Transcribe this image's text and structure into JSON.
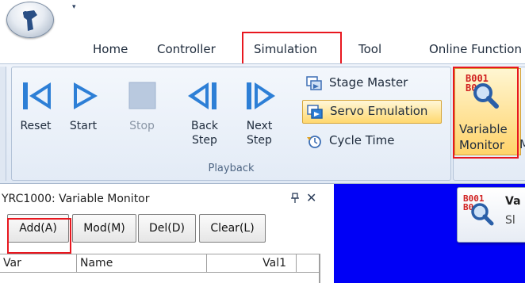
{
  "app": {
    "logo_icon": "robot-arm-icon",
    "qat_dropdown_icon": "quick-access-dropdown-icon"
  },
  "tabs": [
    {
      "label": "Home"
    },
    {
      "label": "Controller"
    },
    {
      "label": "Simulation",
      "highlighted": true
    },
    {
      "label": "Tool"
    },
    {
      "label": "Online Function"
    }
  ],
  "ribbon": {
    "playback_group_label": "Playback",
    "buttons": {
      "reset": "Reset",
      "start": "Start",
      "stop": "Stop",
      "back_step": "Back\nStep",
      "next_step": "Next\nStep"
    },
    "small_buttons": {
      "stage_master": "Stage Master",
      "servo_emulation": "Servo Emulation",
      "cycle_time": "Cycle Time"
    },
    "variable_monitor": "Variable\nMonitor",
    "cutoff_text": "M"
  },
  "panel": {
    "title": "YRC1000: Variable Monitor",
    "buttons": {
      "add": "Add(A)",
      "mod": "Mod(M)",
      "del": "Del(D)",
      "clear": "Clear(L)"
    },
    "columns": [
      "Var",
      "Name",
      "Val1"
    ]
  },
  "tooltip": {
    "title": "Va",
    "subtitle": "Sl"
  },
  "colors": {
    "highlight_red": "#e8171f",
    "blue_area": "#0000f6",
    "icon_blue": "#2d7fd6",
    "active_gold": "#ffd36a"
  }
}
